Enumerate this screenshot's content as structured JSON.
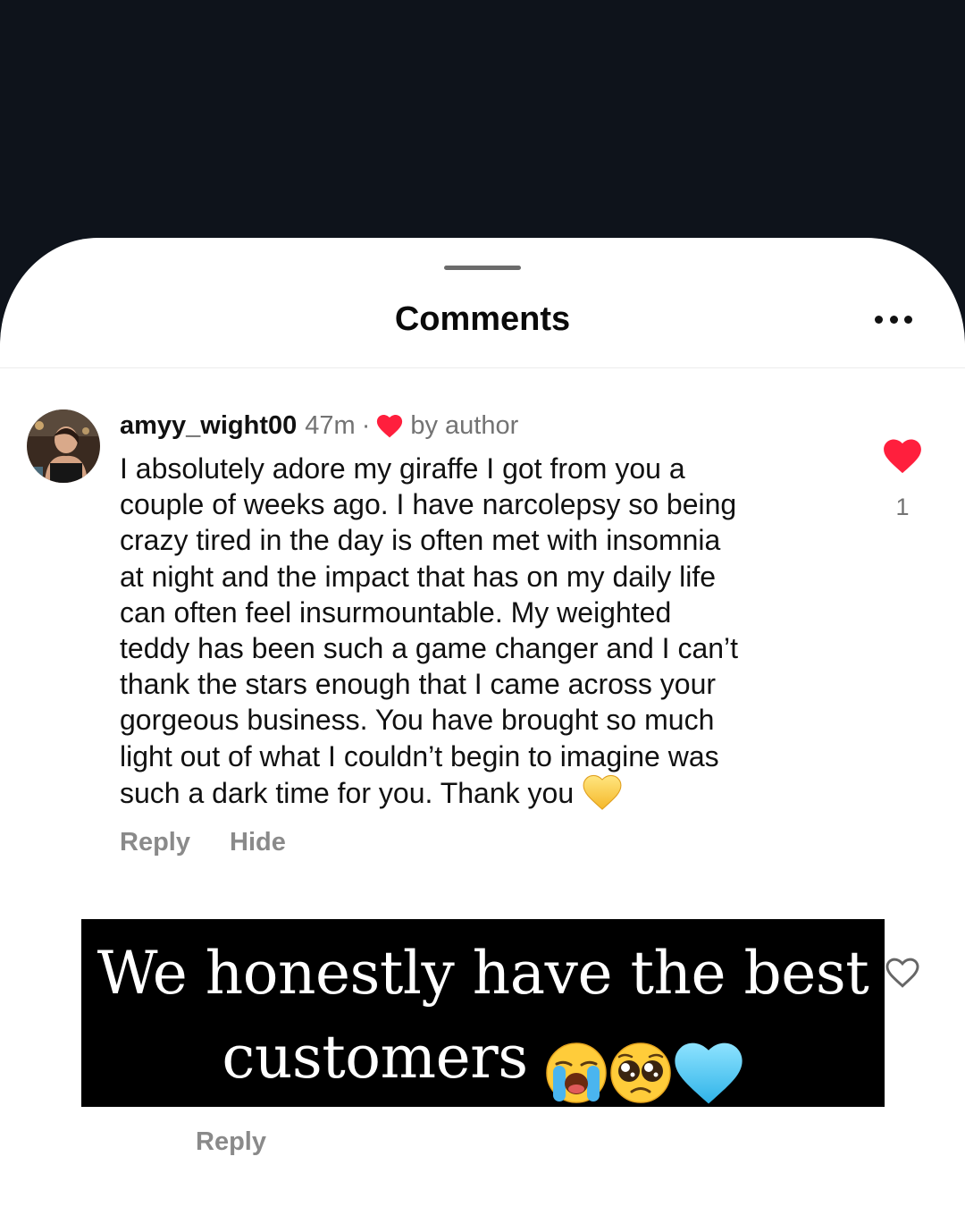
{
  "sheet": {
    "title": "Comments",
    "more_icon": "ellipsis-icon"
  },
  "comment": {
    "username": "amyy_wight00",
    "timestamp": "47m",
    "separator": "·",
    "author_like_icon": "red-heart-icon",
    "author_like_label": "by author",
    "text_lines": [
      "I absolutely adore my giraffe I got from you a",
      "couple of weeks ago. I have narcolepsy so being",
      "crazy tired in the day is often met with insomnia",
      "at night and the impact that has on my daily life",
      "can often feel insurmountable. My weighted",
      "teddy has been such a game changer and I can’t",
      "thank the stars enough that I came across your",
      "gorgeous business. You have brought so much",
      "light out of what I couldn’t begin to imagine was",
      "such a dark time for you. Thank you"
    ],
    "trailing_emoji": "yellow-heart-emoji",
    "like_count": "1",
    "reply_label": "Reply",
    "hide_label": "Hide"
  },
  "overlay": {
    "line1": "We honestly have the best",
    "line2": "customers",
    "emojis": [
      "loudly-crying-face-emoji",
      "pleading-face-emoji",
      "light-blue-heart-emoji"
    ]
  },
  "reply_comment": {
    "reply_label": "Reply"
  },
  "colors": {
    "backdrop": "#0e131b",
    "sheet": "#ffffff",
    "like_red": "#ff1f3d",
    "muted_text": "#737373",
    "overlay_bg": "#000000"
  }
}
